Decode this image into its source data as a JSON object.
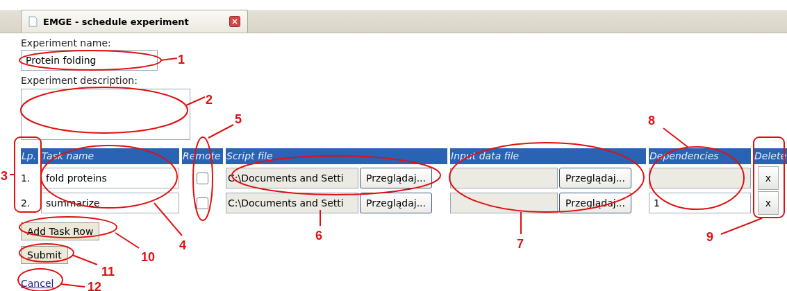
{
  "tab": {
    "title": "EMGE - schedule experiment"
  },
  "form": {
    "name_label": "Experiment name:",
    "name_value": "Protein folding",
    "description_label": "Experiment description:"
  },
  "table": {
    "columns": [
      "Lp.",
      "Task name",
      "Remote",
      "Script file",
      "Input data file",
      "Dependencies",
      "Delete"
    ],
    "rows": [
      {
        "number": "1.",
        "task_name": "fold proteins",
        "remote": false,
        "script_file": "C:\\Documents and Setti",
        "script_browse": "Przeglądaj...",
        "input_browse": "Przeglądaj...",
        "delete": "x"
      },
      {
        "number": "2.",
        "task_name": "summarize",
        "remote": false,
        "script_file": "C:\\Documents and Setti",
        "script_browse": "Przeglądaj...",
        "input_browse": "Przeglądaj...",
        "dependencies": "1",
        "delete": "x"
      }
    ]
  },
  "buttons": {
    "add_row": "Add Task Row",
    "submit": "Submit",
    "cancel": "Cancel"
  },
  "annotations": [
    "1",
    "2",
    "3",
    "4",
    "5",
    "6",
    "7",
    "8",
    "9",
    "10",
    "11",
    "12"
  ]
}
